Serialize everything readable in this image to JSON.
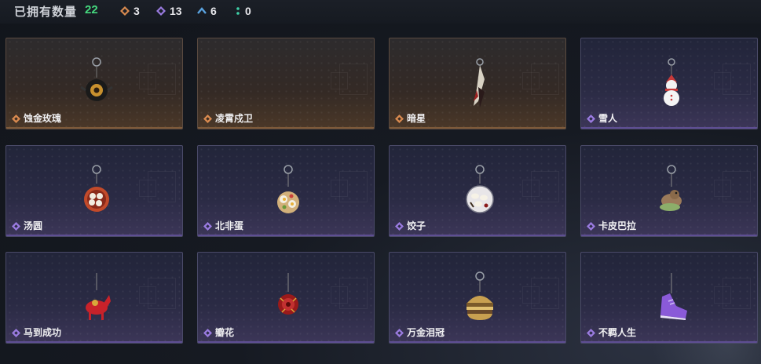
{
  "header": {
    "owned_label": "已拥有数量",
    "owned_count": "22",
    "stats": [
      {
        "icon": "orange-diamond-icon",
        "value": "3",
        "color": "#d98a4f"
      },
      {
        "icon": "purple-diamond-icon",
        "value": "13",
        "color": "#9a7be0"
      },
      {
        "icon": "blue-chevron-icon",
        "value": "6",
        "color": "#5aa3e0"
      },
      {
        "icon": "teal-dots-icon",
        "value": "0",
        "color": "#3fd1a8"
      }
    ]
  },
  "items": [
    {
      "name": "蚀金玫瑰",
      "rarity": "orange"
    },
    {
      "name": "凌霄戍卫",
      "rarity": "orange"
    },
    {
      "name": "暗星",
      "rarity": "orange"
    },
    {
      "name": "雪人",
      "rarity": "purple"
    },
    {
      "name": "汤圆",
      "rarity": "purple"
    },
    {
      "name": "北非蛋",
      "rarity": "purple"
    },
    {
      "name": "饺子",
      "rarity": "purple"
    },
    {
      "name": "卡皮巴拉",
      "rarity": "purple"
    },
    {
      "name": "马到成功",
      "rarity": "purple"
    },
    {
      "name": "瓣花",
      "rarity": "purple"
    },
    {
      "name": "万金泪冠",
      "rarity": "purple"
    },
    {
      "name": "不羁人生",
      "rarity": "purple"
    }
  ]
}
